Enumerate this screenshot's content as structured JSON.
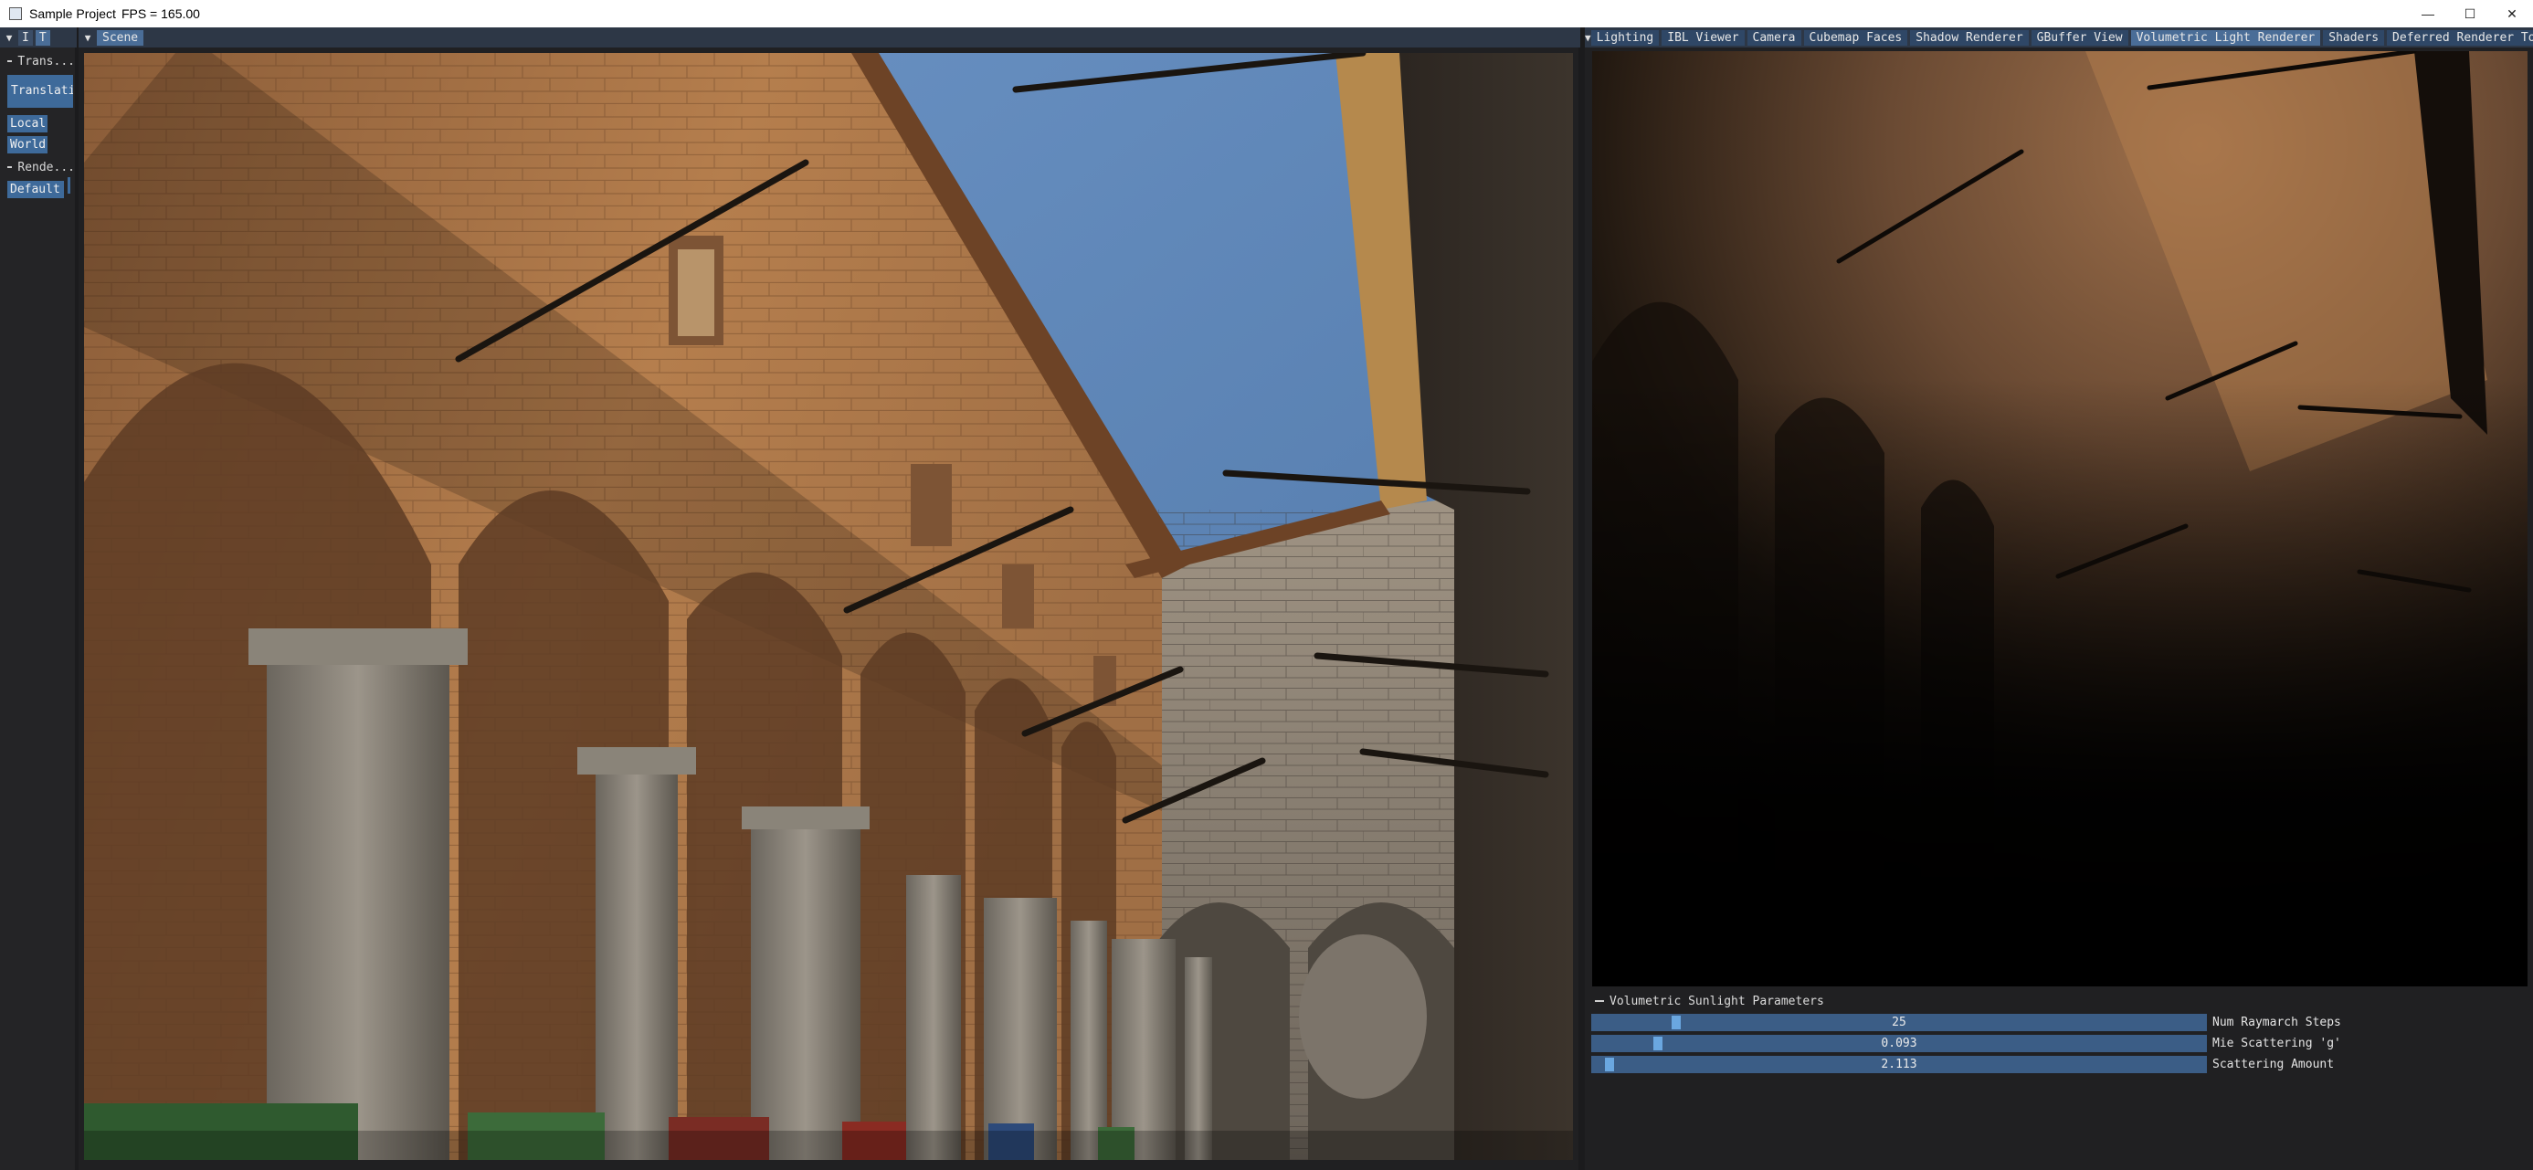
{
  "window": {
    "title": "Sample Project",
    "fps_text": "FPS = 165.00",
    "minimize_glyph": "—",
    "maximize_glyph": "☐",
    "close_glyph": "✕"
  },
  "left_panel": {
    "tabs": [
      "I",
      "T"
    ],
    "sections": {
      "transform": "Trans...",
      "render": "Rende..."
    },
    "buttons": {
      "translation": "Translatio",
      "local": "Local",
      "world": "World",
      "default": "Default"
    }
  },
  "scene": {
    "tab_label": "Scene"
  },
  "right_dock": {
    "tabs": [
      "Lighting",
      "IBL Viewer",
      "Camera",
      "Cubemap Faces",
      "Shadow Renderer",
      "GBuffer View",
      "Volumetric Light Renderer",
      "Shaders",
      "Deferred Renderer Toolbar"
    ],
    "active_tab": "Volumetric Light Renderer"
  },
  "params": {
    "header": "Volumetric Sunlight Parameters",
    "rows": [
      {
        "label": "Num Raymarch Steps",
        "value": "25",
        "fraction": 0.13
      },
      {
        "label": "Mie Scattering 'g'",
        "value": "0.093",
        "fraction": 0.1
      },
      {
        "label": "Scattering Amount",
        "value": "2.113",
        "fraction": 0.02
      }
    ]
  },
  "colors": {
    "accent": "#3e6a9a",
    "tab_active": "#4a6d97",
    "slider_bg": "#3b5d86",
    "slider_grab": "#6aa7e0",
    "sky": "#5e86b8",
    "sandstone": "#b07b4c"
  },
  "icons": {
    "menu_triangle": "▼"
  }
}
